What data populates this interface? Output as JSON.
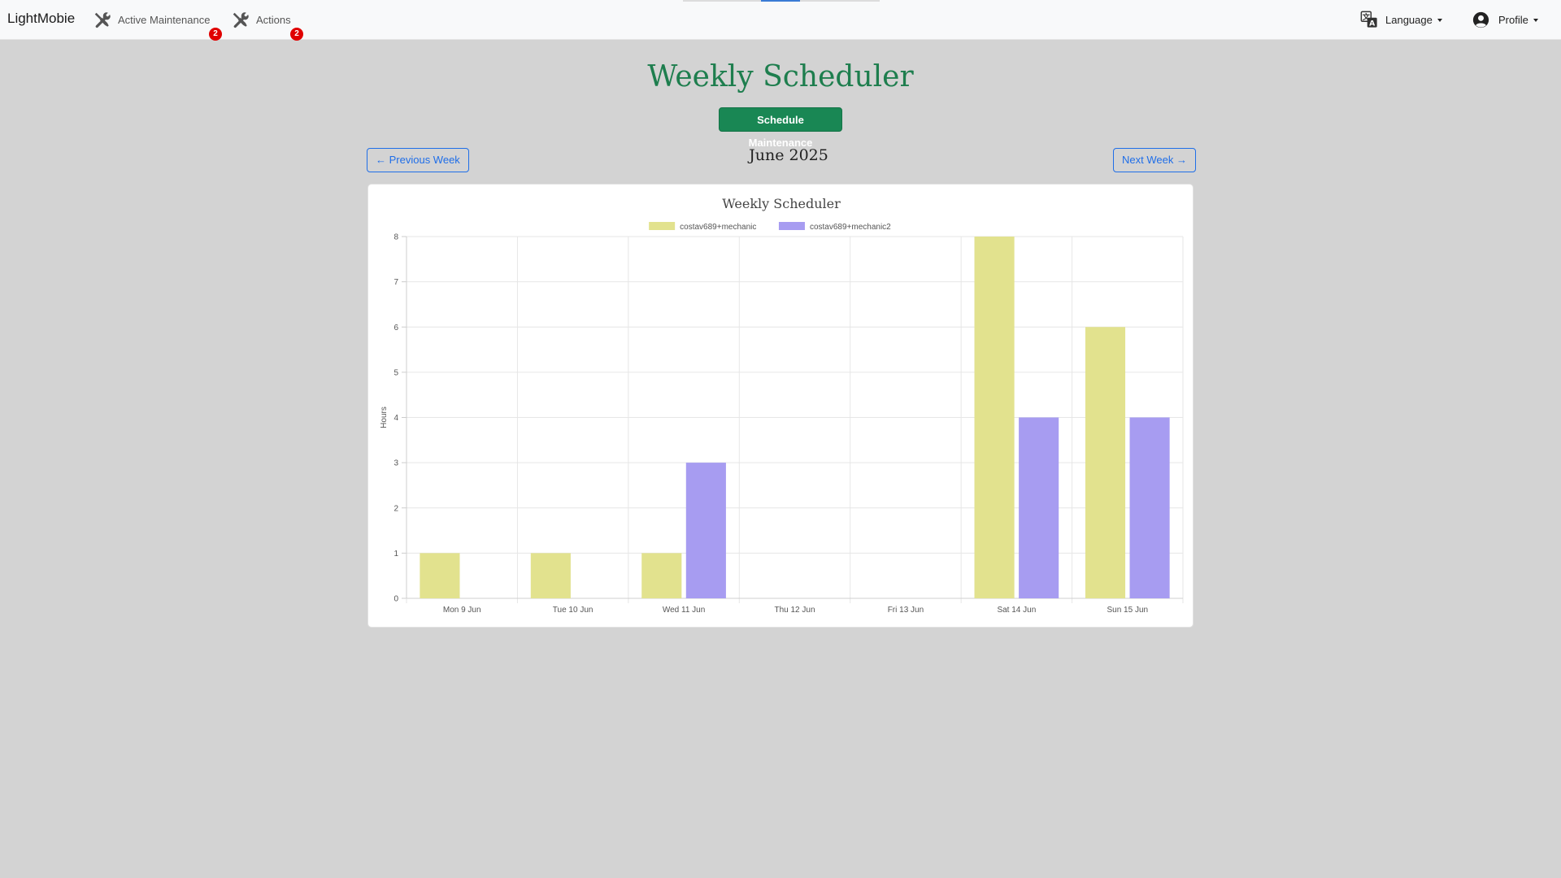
{
  "navbar": {
    "brand": "LightMobie",
    "items": [
      {
        "label": "Active Maintenance",
        "icon": "wrench-screwdriver-icon",
        "badge": "2"
      },
      {
        "label": "Actions",
        "icon": "wrench-screwdriver-icon",
        "badge": "2"
      }
    ],
    "language": {
      "label": "Language",
      "icon": "translate-icon"
    },
    "profile": {
      "label": "Profile",
      "icon": "user-circle-icon"
    }
  },
  "page": {
    "title": "Weekly Scheduler",
    "schedule_button": "Schedule Maintenance",
    "prev_button": "← Previous Week",
    "next_button": "Next Week →",
    "month": "June 2025"
  },
  "colors": {
    "brand_green": "#198754",
    "title_green": "#1e7e4e",
    "link_blue": "#1f6ee8",
    "badge_red": "#e00000",
    "background": "#d3d3d3"
  },
  "chart_data": {
    "type": "bar",
    "title": "Weekly Scheduler",
    "ylabel": "Hours",
    "xlabel": "",
    "ylim": [
      0,
      8
    ],
    "yticks": [
      0,
      1,
      2,
      3,
      4,
      5,
      6,
      7,
      8
    ],
    "grid": true,
    "legend_position": "top-center",
    "categories": [
      "Mon 9 Jun",
      "Tue 10 Jun",
      "Wed 11 Jun",
      "Thu 12 Jun",
      "Fri 13 Jun",
      "Sat 14 Jun",
      "Sun 15 Jun"
    ],
    "series": [
      {
        "name": "costav689+mechanic",
        "color": "#e2e28e",
        "values": [
          1,
          1,
          1,
          0,
          0,
          8,
          6
        ]
      },
      {
        "name": "costav689+mechanic2",
        "color": "#a79cf1",
        "values": [
          0,
          0,
          3,
          0,
          0,
          4,
          4
        ]
      }
    ]
  }
}
